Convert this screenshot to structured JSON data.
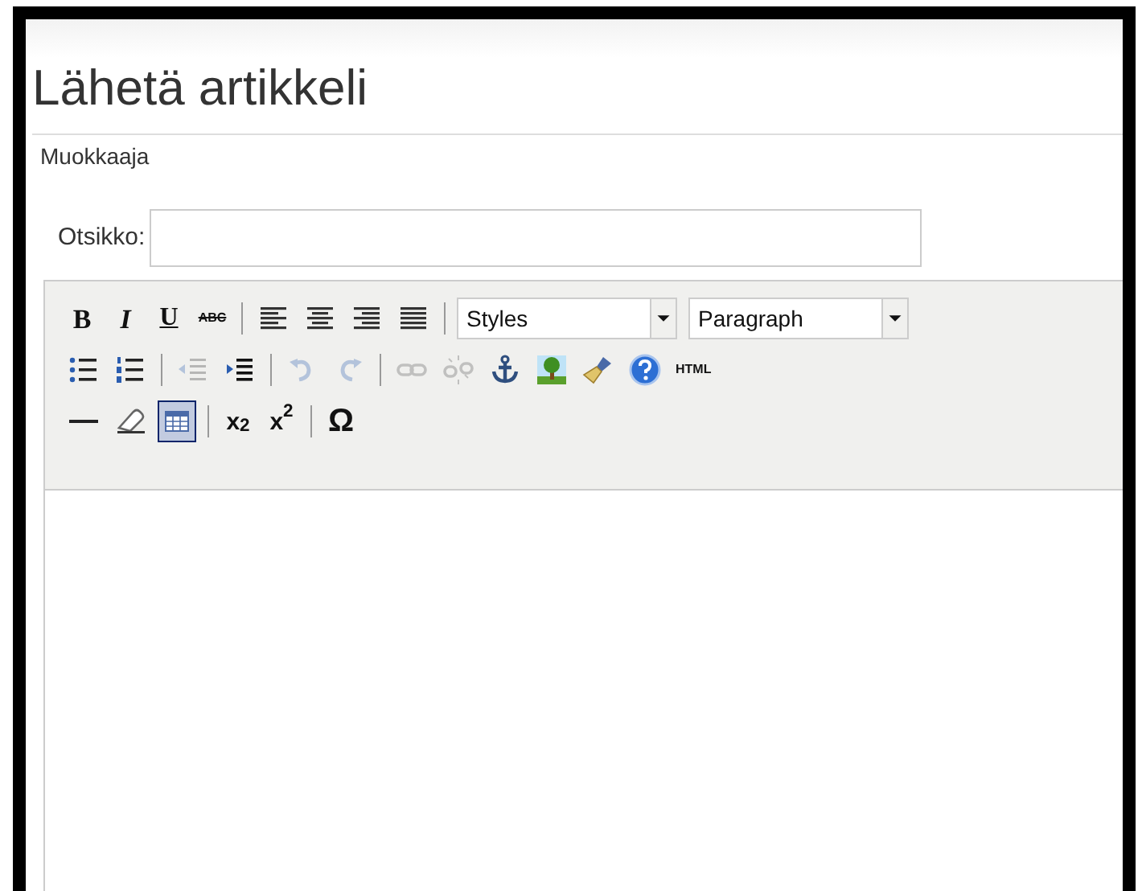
{
  "page_title": "Lähetä artikkeli",
  "section_label": "Muokkaaja",
  "title_field": {
    "label": "Otsikko:"
  },
  "toolbar_rows": [
    [
      {
        "kind": "bold",
        "label": "B",
        "disabled": false,
        "active": false
      },
      {
        "kind": "italic",
        "label": "I",
        "disabled": false,
        "active": false
      },
      {
        "kind": "underline",
        "label": "U",
        "disabled": false,
        "active": false
      },
      {
        "kind": "strike",
        "label": "ABC",
        "disabled": false,
        "active": false
      },
      {
        "kind": "separator"
      },
      {
        "kind": "align-left",
        "disabled": false,
        "active": false
      },
      {
        "kind": "align-center",
        "disabled": false,
        "active": false
      },
      {
        "kind": "align-right",
        "disabled": false,
        "active": false
      },
      {
        "kind": "align-justify",
        "disabled": false,
        "active": false
      },
      {
        "kind": "separator"
      },
      {
        "kind": "dropdown",
        "label": "Styles"
      },
      {
        "kind": "dropdown",
        "label": "Paragraph"
      }
    ],
    [
      {
        "kind": "bullet-list",
        "disabled": false,
        "active": false
      },
      {
        "kind": "number-list",
        "disabled": false,
        "active": false
      },
      {
        "kind": "separator"
      },
      {
        "kind": "outdent",
        "disabled": true,
        "active": false
      },
      {
        "kind": "indent",
        "disabled": false,
        "active": false
      },
      {
        "kind": "separator"
      },
      {
        "kind": "undo",
        "disabled": true,
        "active": false
      },
      {
        "kind": "redo",
        "disabled": true,
        "active": false
      },
      {
        "kind": "separator"
      },
      {
        "kind": "link",
        "disabled": true,
        "active": false
      },
      {
        "kind": "unlink",
        "disabled": true,
        "active": false
      },
      {
        "kind": "anchor",
        "disabled": false,
        "active": false
      },
      {
        "kind": "image",
        "disabled": false,
        "active": false
      },
      {
        "kind": "cleanup",
        "disabled": false,
        "active": false
      },
      {
        "kind": "help",
        "disabled": false,
        "active": false
      },
      {
        "kind": "html",
        "label": "HTML",
        "disabled": false,
        "active": false
      }
    ],
    [
      {
        "kind": "hr",
        "disabled": false,
        "active": false
      },
      {
        "kind": "eraser",
        "disabled": false,
        "active": false
      },
      {
        "kind": "table",
        "disabled": false,
        "active": true
      },
      {
        "kind": "separator"
      },
      {
        "kind": "subscript",
        "label": "x$_{2}$",
        "disabled": false,
        "active": false
      },
      {
        "kind": "superscript",
        "label": "x$^{2}$",
        "disabled": false,
        "active": false
      },
      {
        "kind": "separator"
      },
      {
        "kind": "charmap",
        "label": "Ω",
        "disabled": false,
        "active": false
      }
    ]
  ]
}
